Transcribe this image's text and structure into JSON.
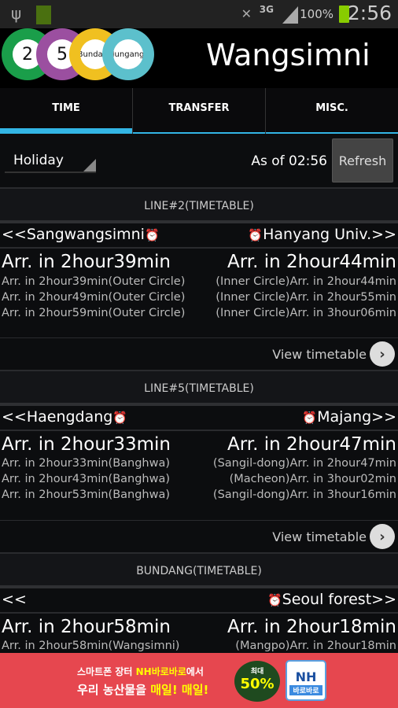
{
  "status": {
    "battery_small": "100%",
    "network": "3G",
    "roaming": "R",
    "battery": "100%",
    "time": "2:56"
  },
  "header": {
    "title": "Wangsimni",
    "lines": [
      {
        "label": "2",
        "color": "#1a9e4a"
      },
      {
        "label": "5",
        "color": "#9b4fa0"
      },
      {
        "label": "Bundang",
        "color": "#f0c020"
      },
      {
        "label": "Jungang",
        "color": "#5cc0cc"
      }
    ]
  },
  "tabs": [
    {
      "label": "TIME",
      "active": true
    },
    {
      "label": "TRANSFER"
    },
    {
      "label": "MISC."
    }
  ],
  "controls": {
    "day_type": "Holiday",
    "as_of": "As of 02:56",
    "refresh": "Refresh"
  },
  "sections": [
    {
      "title": "LINE#2(TIMETABLE)",
      "left_station": "<<Sangwangsimni",
      "right_station": "Hanyang Univ.>>",
      "left_big": "Arr. in 2hour39min",
      "right_big": "Arr. in 2hour44min",
      "left": [
        "Arr. in 2hour39min(Outer Circle)",
        "Arr. in 2hour49min(Outer Circle)",
        "Arr. in 2hour59min(Outer Circle)"
      ],
      "right": [
        "(Inner Circle)Arr. in 2hour44min",
        "(Inner Circle)Arr. in 2hour55min",
        "(Inner Circle)Arr. in 3hour06min"
      ],
      "view": "View timetable"
    },
    {
      "title": "LINE#5(TIMETABLE)",
      "left_station": "<<Haengdang",
      "right_station": "Majang>>",
      "left_big": "Arr. in 2hour33min",
      "right_big": "Arr. in 2hour47min",
      "left": [
        "Arr. in 2hour33min(Banghwa)",
        "Arr. in 2hour43min(Banghwa)",
        "Arr. in 2hour53min(Banghwa)"
      ],
      "right": [
        "(Sangil-dong)Arr. in 2hour47min",
        "(Macheon)Arr. in 3hour02min",
        "(Sangil-dong)Arr. in 3hour16min"
      ],
      "view": "View timetable"
    },
    {
      "title": "BUNDANG(TIMETABLE)",
      "left_station": "<<",
      "right_station": "Seoul forest>>",
      "left_big": "Arr. in 2hour58min",
      "right_big": "Arr. in 2hour18min",
      "left": [
        "Arr. in 2hour58min(Wangsimni)"
      ],
      "right": [
        "(Mangpo)Arr. in 2hour18min"
      ]
    }
  ],
  "ad": {
    "line1_a": "스마트폰 장터 ",
    "line1_b": "NH바로바로",
    "line1_c": "에서",
    "line2_a": "우리 농산물을 ",
    "line2_b": "매일! 매일!",
    "badge_top": "최대",
    "badge": "50%",
    "logo": "NH",
    "logo_sub": "바로바로"
  }
}
